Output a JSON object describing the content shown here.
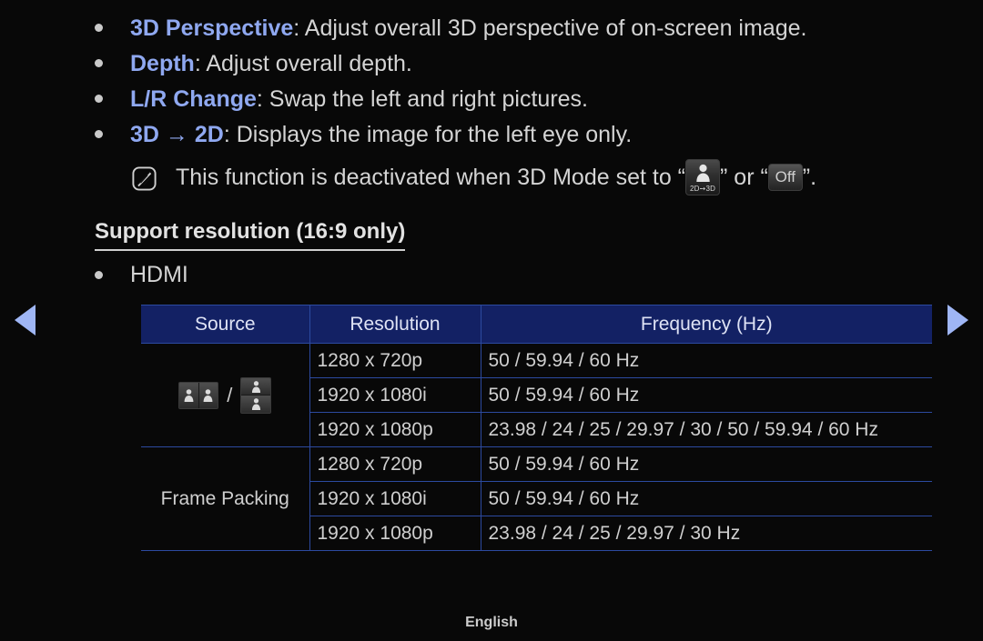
{
  "page": {
    "footer_language": "English",
    "background_color": "#080808",
    "accent_blue": "#8fa8f0",
    "table_header_bg": "#132164",
    "table_border": "#2c4aa0"
  },
  "nav": {
    "prev_label": "Previous page",
    "next_label": "Next page"
  },
  "bullets": [
    {
      "term": "3D Perspective",
      "description": ": Adjust overall 3D perspective of on-screen image."
    },
    {
      "term": "Depth",
      "description": ": Adjust overall depth."
    },
    {
      "term": "L/R Change",
      "description": ": Swap the left and right pictures."
    },
    {
      "term": "3D → 2D",
      "description": ": Displays the image for the left eye only."
    }
  ],
  "note": {
    "icon_name": "note-pen-icon",
    "text_before": "This function is deactivated when 3D Mode set to “",
    "mode_icon_caption": "2D➙3D",
    "text_middle": "” or “",
    "off_label": "Off",
    "text_after": "”."
  },
  "section": {
    "heading": "Support resolution (16:9 only)",
    "hdmi_label": "HDMI"
  },
  "table": {
    "headers": [
      "Source",
      "Resolution",
      "Frequency (Hz)"
    ],
    "groups": [
      {
        "source_type": "icons",
        "source_label": "",
        "rows": [
          {
            "resolution": "1280 x 720p",
            "frequency": "50 / 59.94 / 60 Hz"
          },
          {
            "resolution": "1920 x 1080i",
            "frequency": "50 / 59.94 / 60 Hz"
          },
          {
            "resolution": "1920 x 1080p",
            "frequency": "23.98 / 24 / 25 / 29.97 / 30 / 50 / 59.94 / 60 Hz"
          }
        ]
      },
      {
        "source_type": "text",
        "source_label": "Frame Packing",
        "rows": [
          {
            "resolution": "1280 x 720p",
            "frequency": "50 / 59.94 / 60 Hz"
          },
          {
            "resolution": "1920 x 1080i",
            "frequency": "50 / 59.94 / 60 Hz"
          },
          {
            "resolution": "1920 x 1080p",
            "frequency": "23.98 / 24 / 25 / 29.97 / 30 Hz"
          }
        ]
      }
    ]
  }
}
